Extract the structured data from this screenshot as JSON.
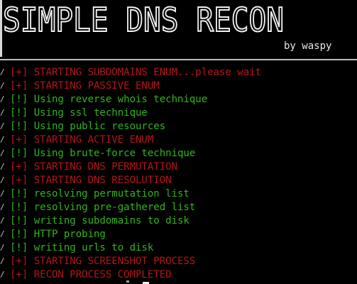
{
  "banner": {
    "title": "SIMPLE DNS RECON",
    "byline": "by waspy"
  },
  "lines": [
    {
      "kind": "warn",
      "text": "[+] STARTING SUBDOMAINS ENUM...please wait"
    },
    {
      "kind": "warn",
      "text": "[+] STARTING PASSIVE ENUM"
    },
    {
      "kind": "ok",
      "text": "[!] Using reverse whois technique"
    },
    {
      "kind": "ok",
      "text": "[!] Using ssl technique"
    },
    {
      "kind": "ok",
      "text": "[!] Using public resources"
    },
    {
      "kind": "warn",
      "text": "[+] STARTING ACTIVE ENUM"
    },
    {
      "kind": "ok",
      "text": "[!] Using brute-force technique"
    },
    {
      "kind": "warn",
      "text": "[+] STARTING DNS PERMUTATION"
    },
    {
      "kind": "warn",
      "text": "[+] STARTING DNS RESOLUTION"
    },
    {
      "kind": "ok",
      "text": "[!] resolving permutation list"
    },
    {
      "kind": "ok",
      "text": "[!] resolving pre-gathered list"
    },
    {
      "kind": "ok",
      "text": "[!] writing subdomains to disk"
    },
    {
      "kind": "ok",
      "text": "[!] HTTP probing"
    },
    {
      "kind": "ok",
      "text": "[!] writing urls to disk"
    },
    {
      "kind": "warn",
      "text": "[+] STARTING SCREENSHOT PROCESS"
    },
    {
      "kind": "warn",
      "text": "[+] RECON PROCESS COMPLETED"
    }
  ],
  "colors": {
    "background": "#000000",
    "warn": "#b3161a",
    "ok": "#32b419",
    "banner": "#f2f2f2",
    "byline": "#e8e8e8"
  }
}
